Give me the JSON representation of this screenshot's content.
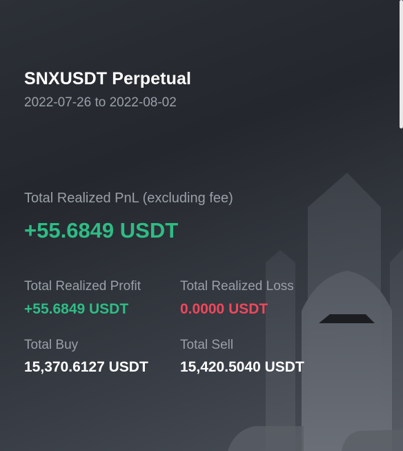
{
  "header": {
    "title": "SNXUSDT Perpetual",
    "date_range": "2022-07-26 to 2022-08-02"
  },
  "pnl": {
    "label": "Total Realized PnL (excluding fee)",
    "value": "+55.6849 USDT"
  },
  "stats": {
    "realized_profit": {
      "label": "Total Realized Profit",
      "value": "+55.6849 USDT"
    },
    "realized_loss": {
      "label": "Total Realized Loss",
      "value": "0.0000 USDT"
    },
    "total_buy": {
      "label": "Total Buy",
      "value": "15,370.6127 USDT"
    },
    "total_sell": {
      "label": "Total Sell",
      "value": "15,420.5040 USDT"
    }
  },
  "colors": {
    "positive": "#2ebd85",
    "negative": "#f0475c",
    "muted_text": "#9aa0a8"
  },
  "decoration": {
    "background_icon": "rocket-illustration"
  }
}
